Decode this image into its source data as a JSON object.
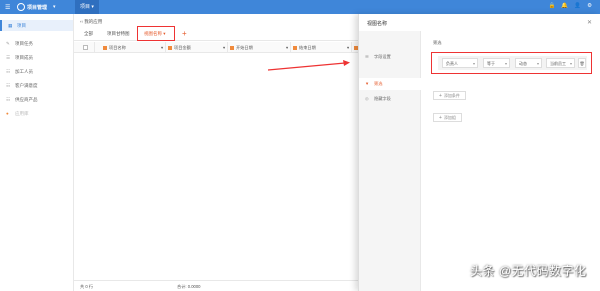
{
  "topbar": {
    "menu_icon": "hamburger-icon",
    "app_title": "项目管理",
    "app_caret": "▾",
    "active_tab": "项目 ▾",
    "icons": [
      "lock-icon",
      "bell-icon",
      "user-icon",
      "settings-icon"
    ]
  },
  "sidebar": {
    "items": [
      {
        "label": "项目",
        "icon": "grid-icon",
        "active": true
      },
      {
        "label": "项目任务",
        "icon": "task-icon"
      },
      {
        "label": "项目成员",
        "icon": "member-icon"
      },
      {
        "label": "加工人员",
        "icon": "worker-icon"
      },
      {
        "label": "客户满意度",
        "icon": "customer-icon"
      },
      {
        "label": "供应商产品",
        "icon": "supplier-icon"
      },
      {
        "label": "应用库",
        "icon": "dot-icon",
        "disabled": true
      }
    ]
  },
  "main": {
    "back_label": "‹‹ 我的应用",
    "tabs": [
      {
        "label": "全部"
      },
      {
        "label": "项目甘特图"
      },
      {
        "label": "视图名称 ▾",
        "selected": true
      }
    ],
    "add_tab": "+",
    "columns": [
      {
        "label": "项目名称"
      },
      {
        "label": "项目金额"
      },
      {
        "label": "开始日期"
      },
      {
        "label": "结束日期"
      }
    ],
    "footer": {
      "total": "共 0 行",
      "sum": "合计: 0.0000"
    }
  },
  "panel": {
    "title": "视图名称",
    "close": "✕",
    "menu": [
      {
        "label": "字段设置",
        "icon": "list-icon"
      },
      {
        "label": "筛选",
        "icon": "filter-icon",
        "selected": true
      },
      {
        "label": "隐藏字段",
        "icon": "hide-icon"
      }
    ],
    "filter_label": "筛选",
    "condition": {
      "field": "负责人",
      "operator": "等于",
      "mode": "动态",
      "value": "当前员工"
    },
    "add_condition": "添加条件",
    "add_group": "添加组"
  },
  "watermark": "头条 @无代码数字化",
  "colors": {
    "brand": "#3f86d9",
    "accent": "#e55a2b",
    "highlight": "#e33333"
  }
}
